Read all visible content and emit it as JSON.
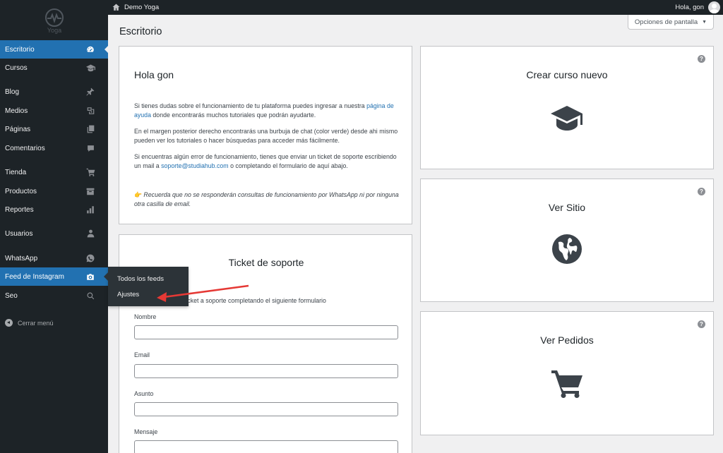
{
  "topbar": {
    "site_name": "Demo Yoga",
    "greeting": "Hola, gon"
  },
  "brand": {
    "logo_text": "Yoga"
  },
  "sidebar": {
    "items": [
      {
        "label": "Escritorio",
        "icon": "dashboard-icon"
      },
      {
        "label": "Cursos",
        "icon": "graduation-cap-icon"
      },
      {
        "label": "Blog",
        "icon": "pin-icon"
      },
      {
        "label": "Medios",
        "icon": "media-icon"
      },
      {
        "label": "Páginas",
        "icon": "pages-icon"
      },
      {
        "label": "Comentarios",
        "icon": "comment-icon"
      },
      {
        "label": "Tienda",
        "icon": "cart-icon"
      },
      {
        "label": "Productos",
        "icon": "archive-icon"
      },
      {
        "label": "Reportes",
        "icon": "bar-chart-icon"
      },
      {
        "label": "Usuarios",
        "icon": "user-icon"
      },
      {
        "label": "WhatsApp",
        "icon": "whatsapp-icon"
      },
      {
        "label": "Feed de Instagram",
        "icon": "camera-icon"
      },
      {
        "label": "Seo",
        "icon": "search-icon"
      }
    ],
    "collapse_label": "Cerrar menú"
  },
  "submenu": {
    "items": [
      "Todos los feeds",
      "Ajustes"
    ]
  },
  "main": {
    "title": "Escritorio",
    "screen_options": "Opciones de pantalla"
  },
  "welcome": {
    "title": "Hola gon",
    "p1_before": "Si tienes dudas sobre el funcionamiento de tu plataforma puedes ingresar a nuestra ",
    "p1_link": "página de ayuda",
    "p1_after": " donde encontrarás muchos tutoriales que podrán ayudarte.",
    "p2": "En el margen posterior derecho encontrarás una burbuja de chat (color verde) desde ahi mismo pueden ver los tutoriales o hacer búsquedas para acceder más fácilmente.",
    "p3_before": "Si encuentras algún error de funcionamiento, tienes que enviar un ticket de soporte escribiendo un mail a ",
    "p3_link": "soporte@studiahub.com",
    "p3_after": " o completando el formulario de aquí abajo.",
    "p4_emoji": "👉",
    "p4": "Recuerda que no se responderán consultas de funcionamiento por WhatsApp ni por ninguna otra casilla de email."
  },
  "ticket": {
    "title": "Ticket de soporte",
    "intro": "Puedes enviar un ticket a soporte completando el siguiente formulario",
    "fields": [
      {
        "label": "Nombre",
        "value": ""
      },
      {
        "label": "Email",
        "value": ""
      },
      {
        "label": "Asunto",
        "value": ""
      },
      {
        "label": "Mensaje",
        "value": ""
      }
    ]
  },
  "actions": [
    {
      "title": "Crear curso nuevo",
      "icon": "graduation-cap-icon",
      "help": "?"
    },
    {
      "title": "Ver Sitio",
      "icon": "globe-icon",
      "help": "?"
    },
    {
      "title": "Ver Pedidos",
      "icon": "cart-icon",
      "help": "?"
    }
  ],
  "colors": {
    "sidebar_bg": "#1d2327",
    "accent": "#2271b1",
    "annotation_arrow": "#e53935"
  }
}
